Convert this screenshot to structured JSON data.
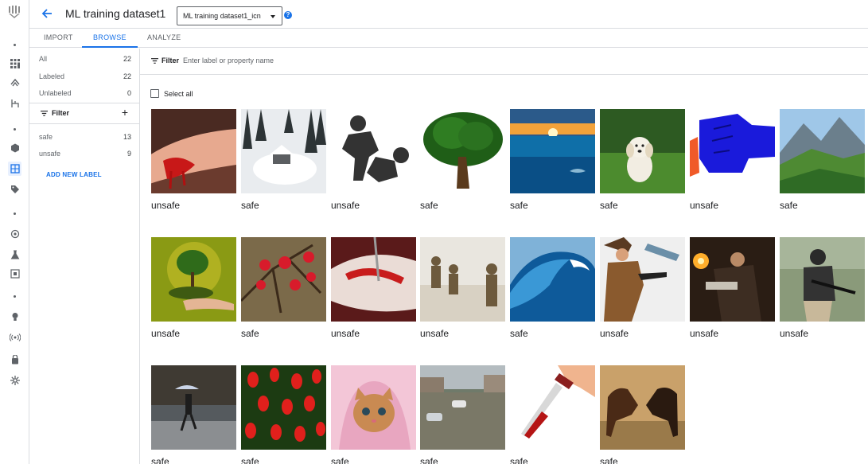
{
  "header": {
    "title": "ML training dataset1",
    "dataset_select": "ML training dataset1_icn",
    "help": "?"
  },
  "tabs": [
    {
      "label": "IMPORT"
    },
    {
      "label": "BROWSE",
      "active": true
    },
    {
      "label": "ANALYZE"
    }
  ],
  "sidebar": {
    "summary": [
      {
        "label": "All",
        "count": "22"
      },
      {
        "label": "Labeled",
        "count": "22"
      },
      {
        "label": "Unlabeled",
        "count": "0"
      }
    ],
    "filter_label": "Filter",
    "labels": [
      {
        "label": "safe",
        "count": "13"
      },
      {
        "label": "unsafe",
        "count": "9"
      }
    ],
    "add_new_label": "ADD NEW LABEL"
  },
  "filterbar": {
    "label": "Filter",
    "placeholder": "Enter label or property name"
  },
  "select_all": "Select all",
  "images": [
    {
      "label": "unsafe",
      "icon": "bleeding-finger"
    },
    {
      "label": "safe",
      "icon": "snowy-forest"
    },
    {
      "label": "unsafe",
      "icon": "fighting-figures"
    },
    {
      "label": "safe",
      "icon": "tree"
    },
    {
      "label": "safe",
      "icon": "ocean-sunset"
    },
    {
      "label": "safe",
      "icon": "puppy"
    },
    {
      "label": "unsafe",
      "icon": "fist"
    },
    {
      "label": "safe",
      "icon": "mountain-valley"
    },
    {
      "label": "unsafe",
      "icon": "tree-in-hand"
    },
    {
      "label": "safe",
      "icon": "red-berries"
    },
    {
      "label": "unsafe",
      "icon": "surgery"
    },
    {
      "label": "unsafe",
      "icon": "soldiers"
    },
    {
      "label": "safe",
      "icon": "wave"
    },
    {
      "label": "unsafe",
      "icon": "gunman"
    },
    {
      "label": "unsafe",
      "icon": "shootout"
    },
    {
      "label": "unsafe",
      "icon": "armed-soldier"
    },
    {
      "label": "safe",
      "icon": "rainy-street"
    },
    {
      "label": "safe",
      "icon": "tulips"
    },
    {
      "label": "safe",
      "icon": "kitten"
    },
    {
      "label": "safe",
      "icon": "flooded-street"
    },
    {
      "label": "safe",
      "icon": "bloody-knife"
    },
    {
      "label": "safe",
      "icon": "fighting-horses"
    }
  ],
  "colors": {
    "accent": "#1a73e8",
    "text": "#202124",
    "muted": "#5f6368",
    "border": "#dadce0"
  }
}
